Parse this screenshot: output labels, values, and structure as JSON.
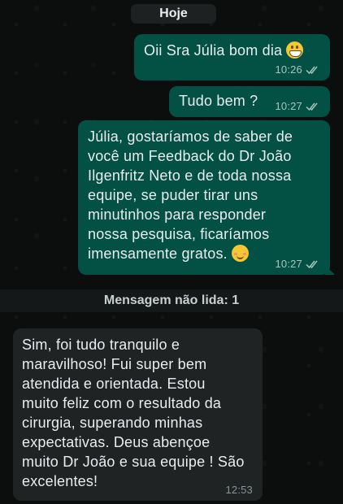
{
  "chat": {
    "date_label": "Hoje",
    "unread_label": "Mensagem não lida: 1"
  },
  "messages": [
    {
      "direction": "outgoing",
      "text": "Oii Sra Júlia bom dia",
      "emoji": "grinning-face",
      "time": "10:26",
      "status": "read"
    },
    {
      "direction": "outgoing",
      "text": "Tudo bem ?",
      "time": "10:27",
      "status": "read"
    },
    {
      "direction": "outgoing",
      "text": "Júlia, gostaríamos de saber de\nvocê um Feedback do Dr João\nIlgenfritz Neto e de toda nossa\nequipe, se puder tirar uns\nminutinhos para responder\nnossa pesquisa, ficaríamos\nimensamente gratos.",
      "emoji": "smiling-face",
      "time": "10:27",
      "status": "read"
    },
    {
      "direction": "incoming",
      "text": "Sim, foi tudo tranquilo e\nmaravilhoso!  Fui super bem\natendida e orientada. Estou\nmuito feliz com o resultado da\ncirurgia, superando minhas\nexpectativas.  Deus abençoe\nmuito Dr João e sua equipe ! São\nexcelentes!",
      "time": "12:53"
    }
  ],
  "colors": {
    "outgoing_bubble": "#025144",
    "incoming_bubble": "#1f2324",
    "read_ticks": "#a9c4bd"
  }
}
